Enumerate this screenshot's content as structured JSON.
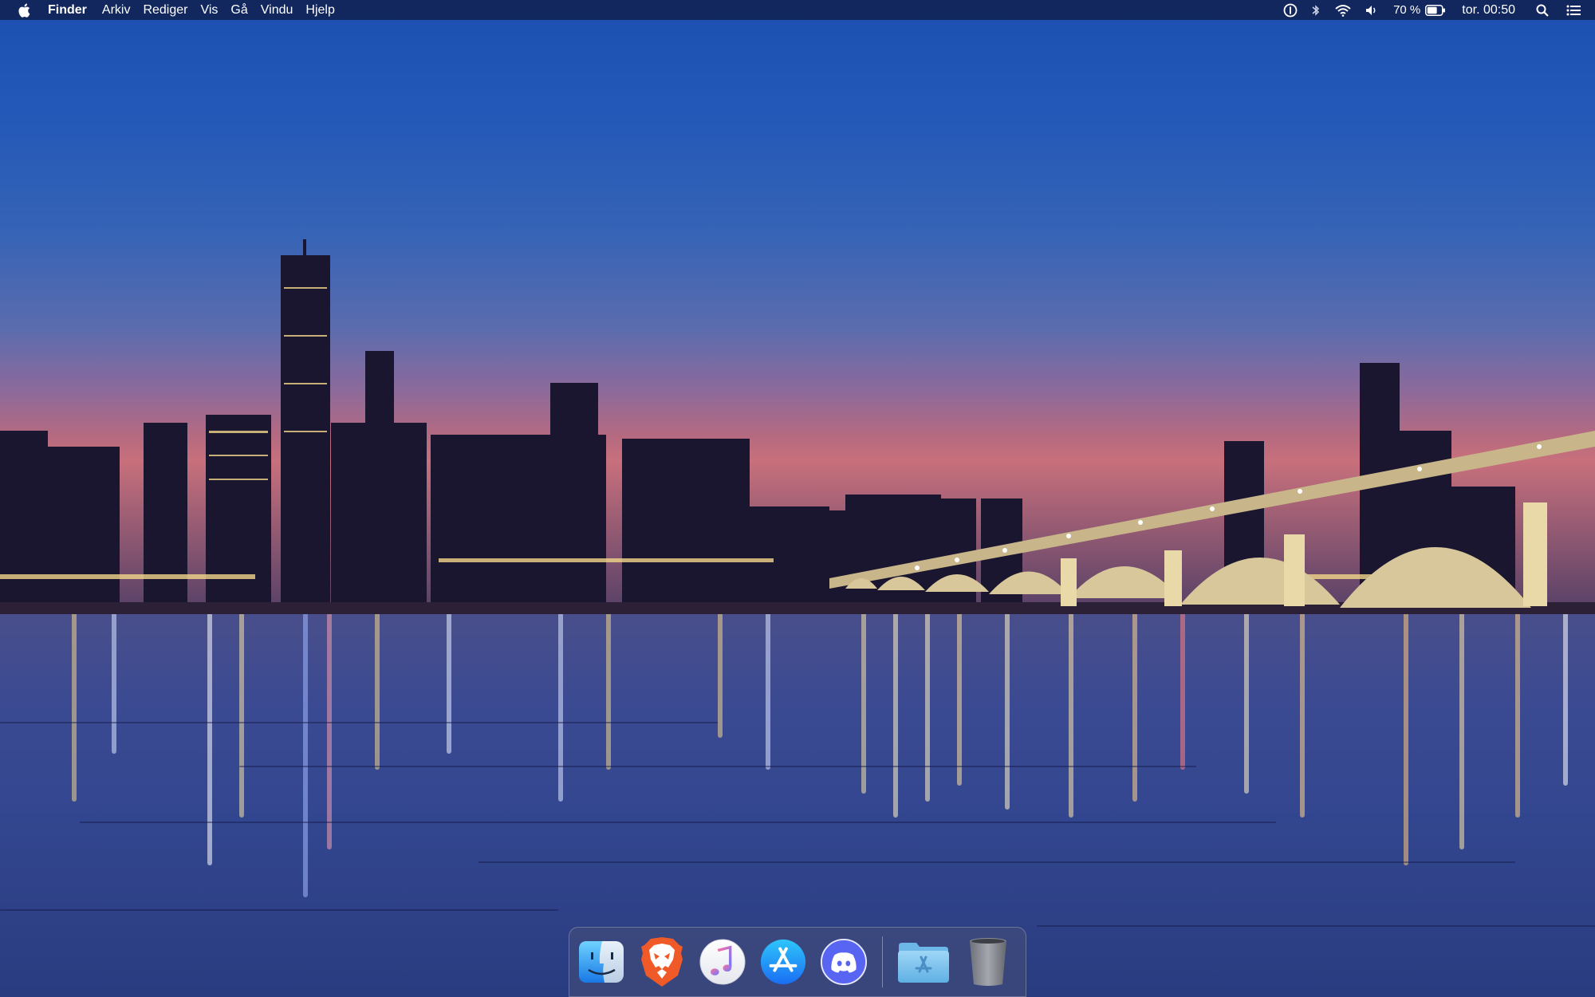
{
  "menubar": {
    "apple_icon": "apple-logo-icon",
    "items": [
      "Finder",
      "Arkiv",
      "Rediger",
      "Vis",
      "Gå",
      "Vindu",
      "Hjelp"
    ],
    "status": {
      "icons": [
        "onepassword-icon",
        "bluetooth-icon",
        "wifi-icon",
        "volume-icon"
      ],
      "battery_percent": "70 %",
      "battery_level": 0.7,
      "clock": "tor. 00:50",
      "right_icons": [
        "spotlight-search-icon",
        "notification-center-icon"
      ]
    }
  },
  "dock": {
    "apps": [
      {
        "name": "Finder",
        "icon": "finder-icon"
      },
      {
        "name": "Brave",
        "icon": "brave-icon"
      },
      {
        "name": "Music",
        "icon": "music-icon"
      },
      {
        "name": "App Store",
        "icon": "app-store-icon"
      },
      {
        "name": "Discord",
        "icon": "discord-icon"
      }
    ],
    "right": [
      {
        "name": "Applications",
        "icon": "applications-folder-icon"
      },
      {
        "name": "Trash",
        "icon": "trash-icon"
      }
    ]
  },
  "colors": {
    "menubar_bg": "#0e1c46",
    "brave_orange": "#f05a28",
    "discord_blue": "#5865f2",
    "appstore_blue": "#1a8cf3"
  }
}
